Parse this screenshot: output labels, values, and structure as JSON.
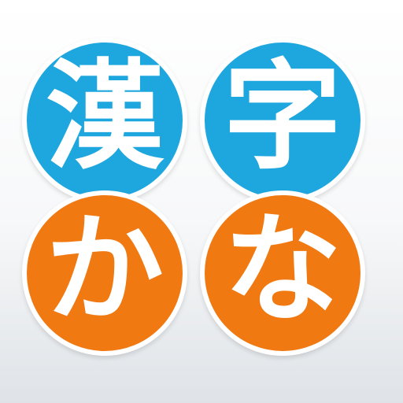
{
  "app_icon": {
    "top_row": [
      {
        "text": "漢",
        "color": "#1ea7df"
      },
      {
        "text": "字",
        "color": "#1ea7df"
      }
    ],
    "bottom_row": [
      {
        "text": "か",
        "color": "#f07912"
      },
      {
        "text": "な",
        "color": "#f07912"
      }
    ],
    "outline_color": "#ffffff",
    "text_color": "#ffffff"
  }
}
